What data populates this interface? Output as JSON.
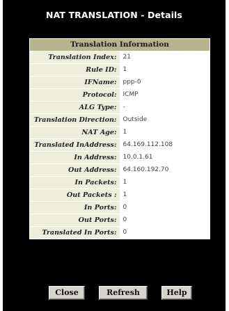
{
  "window": {
    "title": "NAT TRANSLATION - Details"
  },
  "table": {
    "header": "Translation Information",
    "rows": [
      {
        "label": "Translation Index:",
        "value": "21"
      },
      {
        "label": "Rule ID:",
        "value": "1"
      },
      {
        "label": "IFName:",
        "value": "ppp-0"
      },
      {
        "label": "Protocol:",
        "value": "ICMP"
      },
      {
        "label": "ALG Type:",
        "value": "-"
      },
      {
        "label": "Translation Direction:",
        "value": "Outside"
      },
      {
        "label": "NAT Age:",
        "value": "1"
      },
      {
        "label": "Translated InAddress:",
        "value": "64.169.112.108"
      },
      {
        "label": "In Address:",
        "value": "10.0.1.61"
      },
      {
        "label": "Out Address:",
        "value": "64.160.192.70"
      },
      {
        "label": "In Packets:",
        "value": "1"
      },
      {
        "label": "Out Packets :",
        "value": "1"
      },
      {
        "label": "In Ports:",
        "value": "0"
      },
      {
        "label": "Out Ports:",
        "value": "0"
      },
      {
        "label": "Translated In Ports:",
        "value": "0"
      }
    ]
  },
  "buttons": {
    "close": "Close",
    "refresh": "Refresh",
    "help": "Help"
  },
  "colors": {
    "window_background": "#000000",
    "header_background": "#b5b48f",
    "label_background": "#eeeedc",
    "button_face": "#d6d3ce"
  }
}
